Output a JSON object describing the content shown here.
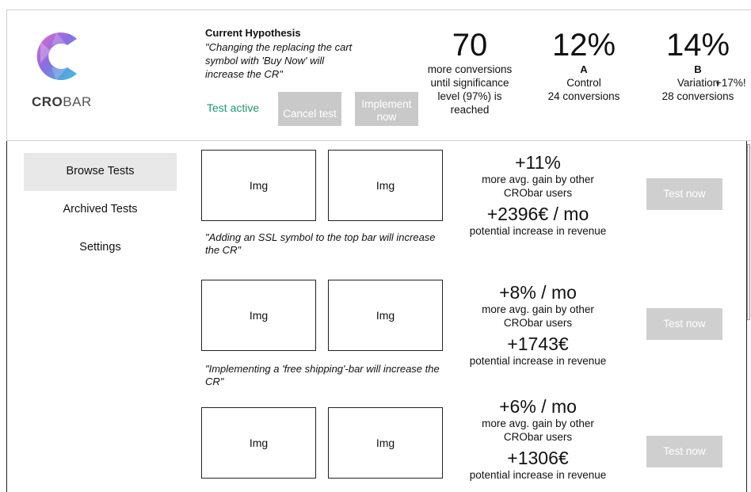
{
  "brand": {
    "logo_strong": "CRO",
    "logo_light": "BAR"
  },
  "hypothesis": {
    "title": "Current Hypothesis",
    "text": "\"Changing the replacing the cart symbol with 'Buy Now' will increase the CR\"",
    "status": "Test active",
    "cancel_label": "Cancel test",
    "implement_label": "Implement now"
  },
  "stats": {
    "conversions_needed": {
      "value": "70",
      "desc": "more conversions until significance level (97%) is reached"
    },
    "variant_a": {
      "value": "12%",
      "label": "A",
      "name": "Control",
      "conversions": "24 conversions"
    },
    "variant_b": {
      "value": "14%",
      "label": "B",
      "name": "Variation",
      "conversions": "28 conversions",
      "uplift": "+17%!"
    }
  },
  "nav": {
    "items": [
      {
        "label": "Browse Tests",
        "active": true
      },
      {
        "label": "Archived Tests",
        "active": false
      },
      {
        "label": "Settings",
        "active": false
      }
    ]
  },
  "tests": [
    {
      "img_a": "Img",
      "img_b": "Img",
      "caption": "\"Adding an SSL symbol to the top bar will increase the CR\"",
      "gain": "+11%",
      "gain_desc": "more avg. gain by other CRObar users",
      "revenue": "+2396€ / mo",
      "revenue_desc": "potential increase in revenue",
      "button": "Test now"
    },
    {
      "img_a": "Img",
      "img_b": "Img",
      "caption": "\"Implementing a 'free shipping'-bar will increase the CR\"",
      "gain": "+8% / mo",
      "gain_desc": "more avg. gain by other CRObar users",
      "revenue": "+1743€",
      "revenue_desc": "potential increase in revenue",
      "button": "Test now"
    },
    {
      "img_a": "Img",
      "img_b": "Img",
      "caption": "",
      "gain": "+6% / mo",
      "gain_desc": "more avg. gain by other CRObar users",
      "revenue": "+1306€",
      "revenue_desc": "potential increase in revenue",
      "button": "Test now"
    }
  ],
  "colors": {
    "status_green": "#1b9a6b",
    "button_gray": "#c9c9c9",
    "nav_active": "#e8e8e8"
  }
}
